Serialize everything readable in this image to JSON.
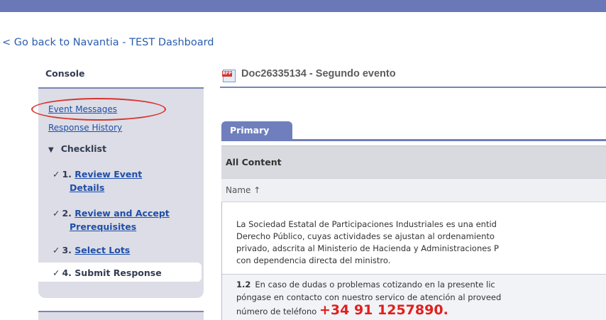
{
  "back_link": "< Go back to Navantia - TEST Dashboard",
  "sidebar": {
    "title": "Console",
    "links": [
      "Event Messages",
      "Response History"
    ],
    "checklist_title": "Checklist",
    "steps": [
      {
        "num": "1.",
        "label_line1": "Review Event",
        "label_line2": "Details"
      },
      {
        "num": "2.",
        "label_line1": "Review and Accept",
        "label_line2": "Prerequisites"
      },
      {
        "num": "3.",
        "label_line1": "Select Lots"
      },
      {
        "num": "4.",
        "label_line1": "Submit Response"
      }
    ]
  },
  "main": {
    "doc_badge": "RFP",
    "doc_title": "Doc26335134 - Segundo evento",
    "tab_label": "Primary",
    "panel_header": "All Content",
    "name_column": "Name ↑",
    "paragraph_lines": [
      "La Sociedad Estatal de Participaciones Industriales es una entid",
      "Derecho Público, cuyas actividades se ajustan al ordenamiento",
      "privado, adscrita al Ministerio de Hacienda y Administraciones P",
      "con dependencia directa del ministro."
    ],
    "item_number": "1.2",
    "item_line1": "En caso de dudas o problemas cotizando en la presente lic",
    "item_line2": "póngase en contacto con nuestro servico de atención al proveed",
    "phone_prefix": "número de teléfono",
    "phone_number": "+34 91 1257890",
    "phone_suffix": "."
  }
}
